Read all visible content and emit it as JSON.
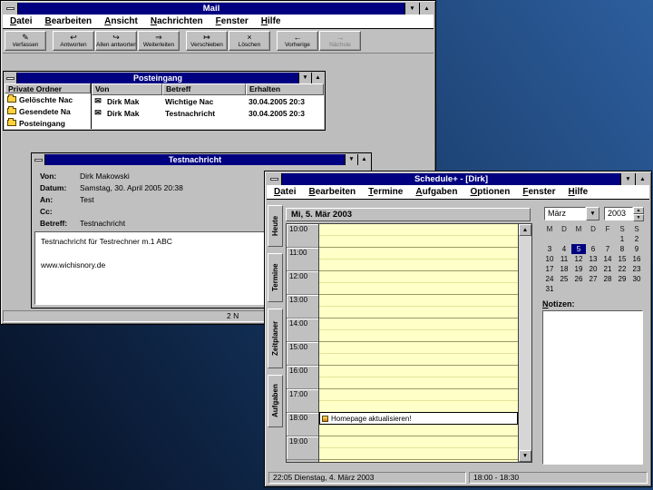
{
  "desktop": {
    "bg_dark": "#060f22",
    "bg_mid": "#14335c",
    "bg_light": "#2d5e9d"
  },
  "mail": {
    "title": "Mail",
    "menu": [
      "Datei",
      "Bearbeiten",
      "Ansicht",
      "Nachrichten",
      "Fenster",
      "Hilfe"
    ],
    "toolbar": [
      {
        "label": "Verfassen",
        "icon": "compose-icon",
        "enabled": true,
        "group_start": false
      },
      {
        "label": "Antworten",
        "icon": "reply-icon",
        "enabled": true,
        "group_start": true
      },
      {
        "label": "Allen antworten",
        "icon": "reply-all-icon",
        "enabled": true,
        "group_start": false
      },
      {
        "label": "Weiterleiten",
        "icon": "forward-icon",
        "enabled": true,
        "group_start": false
      },
      {
        "label": "Verschieben",
        "icon": "move-icon",
        "enabled": true,
        "group_start": true
      },
      {
        "label": "Löschen",
        "icon": "delete-icon",
        "enabled": true,
        "group_start": false
      },
      {
        "label": "Vorherige",
        "icon": "previous-icon",
        "enabled": true,
        "group_start": true
      },
      {
        "label": "Nächste",
        "icon": "next-icon",
        "enabled": false,
        "group_start": false
      }
    ],
    "inbox": {
      "title": "Posteingang",
      "folders_header": "Private Ordner",
      "folders": [
        "Gelöschte Nac",
        "Gesendete Na",
        "Posteingang"
      ],
      "columns": [
        "Von",
        "Betreff",
        "Erhalten"
      ],
      "messages": [
        {
          "von": "Dirk Mak",
          "betreff": "Wichtige Nac",
          "erhalten": "30.04.2005 20:3"
        },
        {
          "von": "Dirk Mak",
          "betreff": "Testnachricht",
          "erhalten": "30.04.2005 20:3"
        }
      ]
    },
    "message_window": {
      "title": "Testnachricht",
      "fields": [
        {
          "label": "Von:",
          "value": "Dirk Makowski"
        },
        {
          "label": "Datum:",
          "value": "Samstag, 30. April 2005 20:38"
        },
        {
          "label": "An:",
          "value": "Test"
        },
        {
          "label": "Cc:",
          "value": ""
        },
        {
          "label": "Betreff:",
          "value": "Testnachricht"
        }
      ],
      "body_line1": "Testnachricht für Testrechner m.1 ABC",
      "body_line2": "www.wichisnory.de"
    },
    "status": "2 N"
  },
  "schedule": {
    "title": "Schedule+ - [Dirk]",
    "menu": [
      "Datei",
      "Bearbeiten",
      "Termine",
      "Aufgaben",
      "Optionen",
      "Fenster",
      "Hilfe"
    ],
    "tabs": [
      "Heute",
      "Termine",
      "Zeitplaner",
      "Aufgaben"
    ],
    "date_header": "Mi, 5. Mär 2003",
    "hours": [
      "10:00",
      "11:00",
      "12:00",
      "13:00",
      "14:00",
      "15:00",
      "16:00",
      "17:00",
      "18:00",
      "19:00"
    ],
    "appointment": {
      "row_time": "18:00",
      "text": "Homepage aktualisieren!"
    },
    "month": "März",
    "year": "2003",
    "day_headers": [
      "M",
      "D",
      "M",
      "D",
      "F",
      "S",
      "S"
    ],
    "weeks": [
      [
        "",
        "",
        "",
        "",
        "",
        "1",
        "2"
      ],
      [
        "3",
        "4",
        "5",
        "6",
        "7",
        "8",
        "9"
      ],
      [
        "10",
        "11",
        "12",
        "13",
        "14",
        "15",
        "16"
      ],
      [
        "17",
        "18",
        "19",
        "20",
        "21",
        "22",
        "23"
      ],
      [
        "24",
        "25",
        "26",
        "27",
        "28",
        "29",
        "30"
      ],
      [
        "31",
        "",
        "",
        "",
        "",
        "",
        ""
      ]
    ],
    "selected_day": "5",
    "notes_label": "Notizen:",
    "status_left": "22:05 Dienstag, 4. März 2003",
    "status_right": "18:00 - 18:30"
  }
}
